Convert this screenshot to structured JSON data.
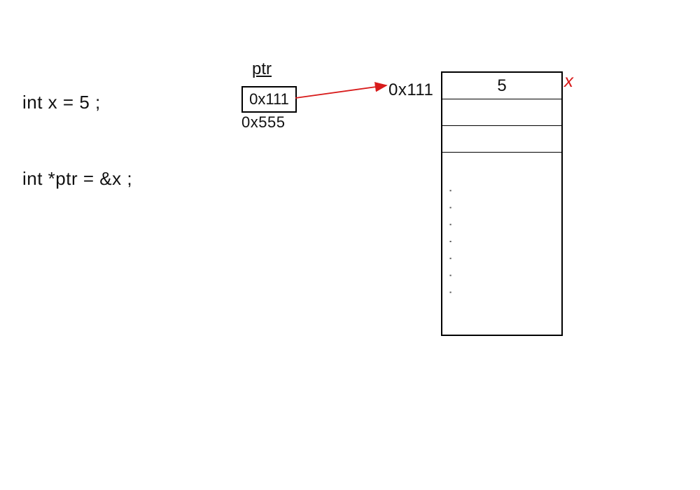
{
  "code": {
    "line1": "int x = 5 ;",
    "line2": "int *ptr = &x ;"
  },
  "pointer": {
    "label": "ptr",
    "value": "0x111",
    "own_address": "0x555"
  },
  "memory": {
    "target_address": "0x111",
    "cells": {
      "c0": "5",
      "c1": "",
      "c2": ""
    },
    "ellipsis": "· · · · · · ·",
    "var_label": "x"
  },
  "colors": {
    "arrow": "#d81b1b",
    "ink": "#111111",
    "var_label": "#d81b1b"
  }
}
